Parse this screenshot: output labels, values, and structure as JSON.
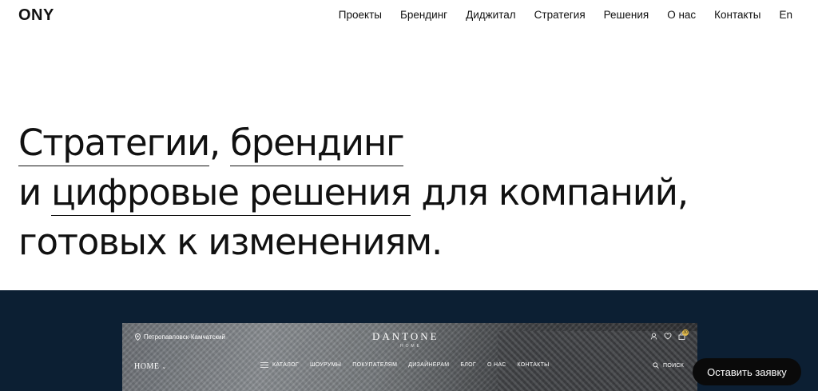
{
  "header": {
    "logo": "ONY",
    "nav": [
      "Проекты",
      "Брендинг",
      "Диджитал",
      "Стратегия",
      "Решения",
      "О нас",
      "Контакты",
      "En"
    ]
  },
  "hero": {
    "line1_a": "Стратегии",
    "line1_sep": ", ",
    "line1_b": "брендинг",
    "line2_pre": "и ",
    "line2_u": "цифровые решения",
    "line2_post": " для компаний,",
    "line3": "готовых к изменениям."
  },
  "showcase": {
    "location": "Петропавловск-Камчатский",
    "brand": "DANTONE",
    "brand_sub": "HOME",
    "home_menu": "HOME",
    "menu": [
      "КАТАЛОГ",
      "ШОУРУМЫ",
      "ПОКУПАТЕЛЯМ",
      "ДИЗАЙНЕРАМ",
      "БЛОГ",
      "О НАС",
      "КОНТАКТЫ"
    ],
    "search": "ПОИСК",
    "cart_count": "30"
  },
  "cta": {
    "label": "Оставить заявку"
  },
  "colors": {
    "band": "#0c1f33",
    "cta_bg": "#0a0a0a",
    "text": "#111111"
  }
}
